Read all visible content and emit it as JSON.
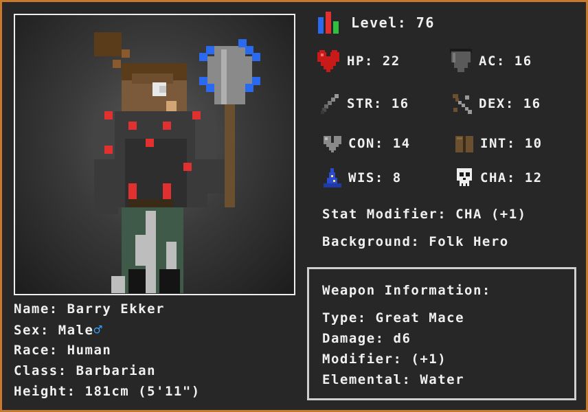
{
  "character": {
    "name_label": "Name: Barry Ekker",
    "sex_label": "Sex: Male",
    "sex_symbol": "♂",
    "race_label": "Race: Human",
    "class_label": "Class: Barbarian",
    "height_label": "Height: 181cm (5'11\")"
  },
  "level": {
    "text": "Level: 76"
  },
  "stats": {
    "hp": "HP: 22",
    "ac": "AC: 16",
    "str": "STR: 16",
    "dex": "DEX: 16",
    "con": "CON: 14",
    "int": "INT: 10",
    "wis": "WIS: 8",
    "cha": "CHA: 12"
  },
  "stat_modifier": "Stat Modifier: CHA (+1)",
  "background": "Background: Folk Hero",
  "weapon": {
    "heading": "Weapon Information:",
    "type": "Type: Great Mace",
    "damage": "Damage: d6",
    "modifier": "Modifier: (+1)",
    "elemental": "Elemental: Water"
  },
  "icons": {
    "level": "bar-chart-icon",
    "hp": "heart-icon",
    "ac": "shield-icon",
    "str": "sword-icon",
    "dex": "crossbow-icon",
    "con": "grey-heart-icon",
    "int": "book-icon",
    "wis": "wizard-hat-icon",
    "cha": "skull-icon"
  },
  "colors": {
    "border": "#c77a2e",
    "background": "#272727",
    "text": "#f0f0f0",
    "accent_blue": "#3aa0ff"
  }
}
